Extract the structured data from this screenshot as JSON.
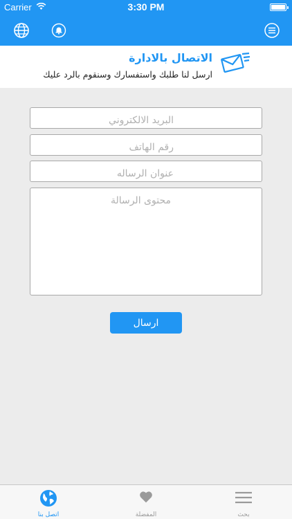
{
  "status_bar": {
    "carrier": "Carrier",
    "time": "3:30 PM"
  },
  "nav_bar": {
    "left_icons": [
      "globe-icon",
      "bell-icon"
    ],
    "right_icon": "menu-icon"
  },
  "header": {
    "title": "الاتصال بالادارة",
    "subtitle": "ارسل لنا طلبك واستفسارك وسنقوم بالرد عليك",
    "icon": "mail-icon"
  },
  "form": {
    "email_placeholder": "البريد الالكتروني",
    "phone_placeholder": "رقم الهاتف",
    "subject_placeholder": "عنوان الرساله",
    "content_placeholder": "محتوى الرسالة",
    "send_label": "ارسال"
  },
  "tab_bar": {
    "items": [
      {
        "label": "اتصل بنا",
        "icon": "globe-icon",
        "active": true
      },
      {
        "label": "المفضلة",
        "icon": "heart-icon",
        "active": false
      },
      {
        "label": "بحث",
        "icon": "menu-icon",
        "active": false
      }
    ]
  },
  "colors": {
    "accent": "#2196f3",
    "background": "#ececec",
    "inactive_tab": "#9a9a9a"
  }
}
